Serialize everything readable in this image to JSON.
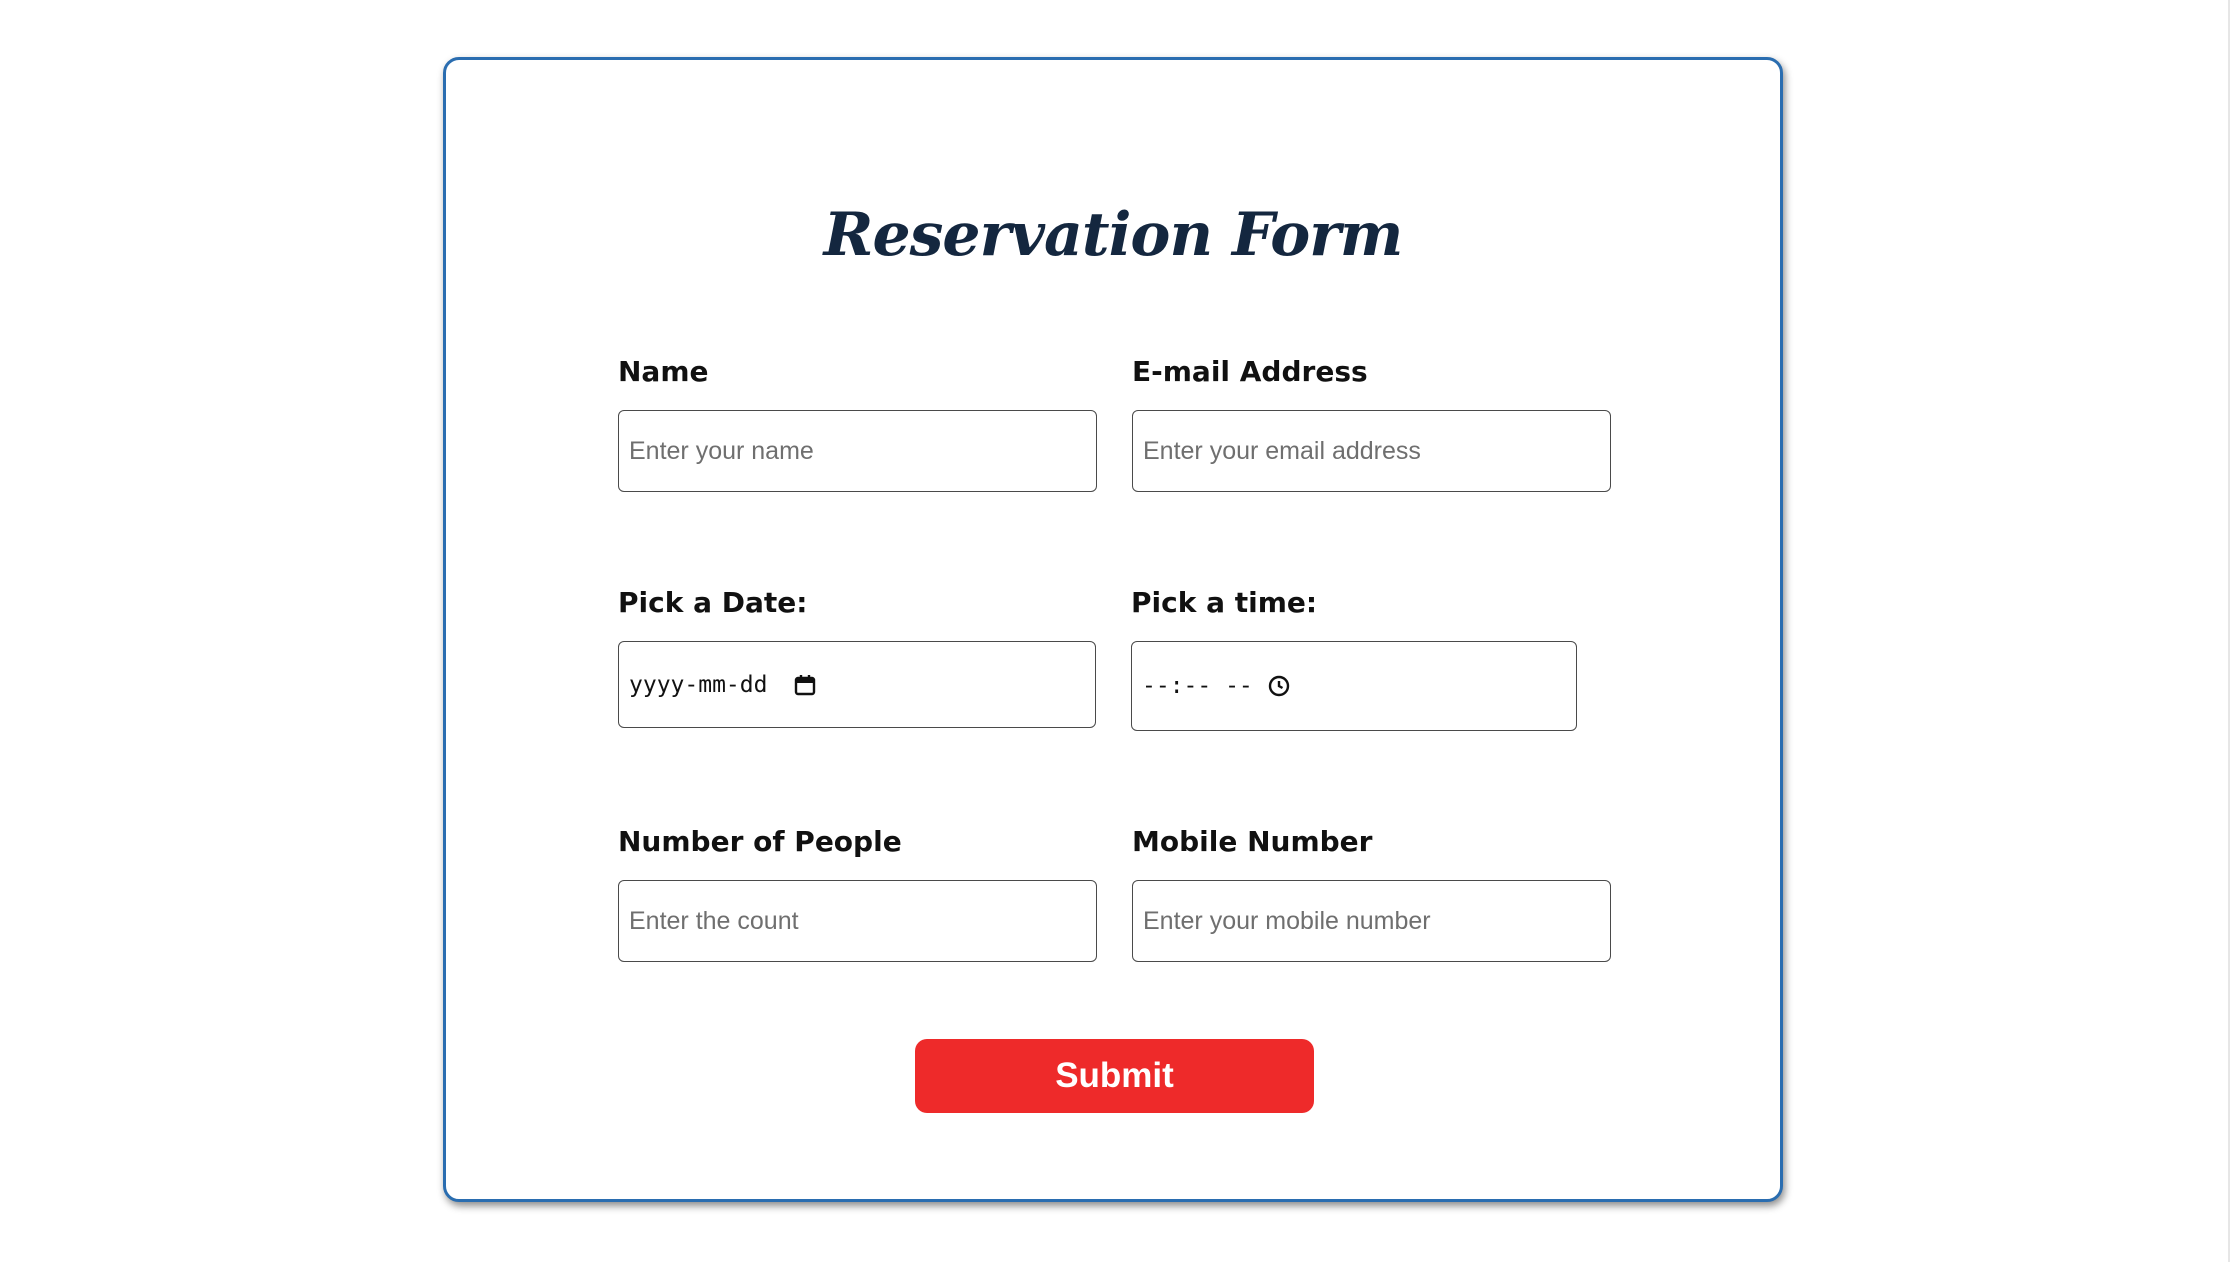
{
  "form": {
    "title": "Reservation Form",
    "fields": {
      "name": {
        "label": "Name",
        "placeholder": "Enter your name"
      },
      "email": {
        "label": "E-mail Address",
        "placeholder": "Enter your email address"
      },
      "date": {
        "label": "Pick a Date:",
        "placeholder": "yyyy-mm-dd"
      },
      "time": {
        "label": "Pick a time:",
        "placeholder": "--:-- --"
      },
      "people": {
        "label": "Number of People",
        "placeholder": "Enter the count"
      },
      "mobile": {
        "label": "Mobile Number",
        "placeholder": "Enter your mobile number"
      }
    },
    "submit_label": "Submit"
  },
  "colors": {
    "card_border": "#2a6db0",
    "title": "#14273f",
    "submit_bg": "#ee2a2a",
    "submit_text": "#ffffff"
  },
  "icons": {
    "date": "calendar-icon",
    "time": "clock-icon"
  }
}
